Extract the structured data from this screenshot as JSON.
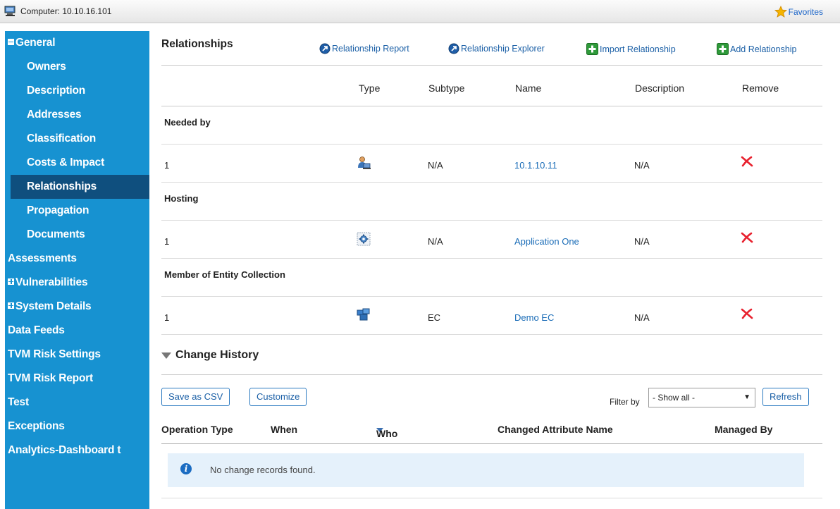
{
  "window": {
    "computer_label": "Computer: 10.10.16.101",
    "favorites_label": "Favorites"
  },
  "sidebar": {
    "items": [
      {
        "label": "General",
        "level": "top",
        "toggle": "minus"
      },
      {
        "label": "Owners",
        "level": "sub"
      },
      {
        "label": "Description",
        "level": "sub"
      },
      {
        "label": "Addresses",
        "level": "sub"
      },
      {
        "label": "Classification",
        "level": "sub"
      },
      {
        "label": "Costs & Impact",
        "level": "sub"
      },
      {
        "label": "Relationships",
        "level": "sub",
        "active": true
      },
      {
        "label": "Propagation",
        "level": "sub"
      },
      {
        "label": "Documents",
        "level": "sub"
      },
      {
        "label": "Assessments",
        "level": "top"
      },
      {
        "label": "Vulnerabilities",
        "level": "top",
        "toggle": "plus"
      },
      {
        "label": "System Details",
        "level": "top",
        "toggle": "plus"
      },
      {
        "label": "Data Feeds",
        "level": "top"
      },
      {
        "label": "TVM Risk Settings",
        "level": "top"
      },
      {
        "label": "TVM Risk Report",
        "level": "top"
      },
      {
        "label": "Test",
        "level": "top"
      },
      {
        "label": "Exceptions",
        "level": "top"
      },
      {
        "label": "Analytics-Dashboard t",
        "level": "top"
      }
    ]
  },
  "relationships": {
    "title": "Relationships",
    "actions": {
      "report": "Relationship Report",
      "explorer": "Relationship Explorer",
      "import": "Import Relationship",
      "add": "Add Relationship"
    },
    "columns": {
      "type": "Type",
      "subtype": "Subtype",
      "name": "Name",
      "description": "Description",
      "remove": "Remove"
    },
    "groups": [
      {
        "label": "Needed by",
        "row": {
          "count": "1",
          "type_icon": "person-computer-icon",
          "subtype": "N/A",
          "name": "10.1.10.11",
          "description": "N/A"
        }
      },
      {
        "label": "Hosting",
        "row": {
          "count": "1",
          "type_icon": "application-gear-icon",
          "subtype": "N/A",
          "name": "Application One",
          "description": "N/A"
        }
      },
      {
        "label": "Member of Entity Collection",
        "row": {
          "count": "1",
          "type_icon": "entity-collection-icon",
          "subtype": "EC",
          "name": "Demo EC",
          "description": "N/A"
        }
      }
    ]
  },
  "change_history": {
    "title": "Change History",
    "save_csv": "Save as CSV",
    "customize": "Customize",
    "filter_label": "Filter by",
    "filter_value": "- Show all -",
    "refresh": "Refresh",
    "columns": {
      "operation_type": "Operation Type",
      "when": "When",
      "who": "Who",
      "changed_attribute": "Changed Attribute Name",
      "managed_by": "Managed By"
    },
    "empty_message": "No change records found."
  },
  "colors": {
    "sidebar": "#1792d1",
    "sidebar_active": "#0f4f7e",
    "link": "#1a6cb7",
    "remove": "#e8212e"
  }
}
